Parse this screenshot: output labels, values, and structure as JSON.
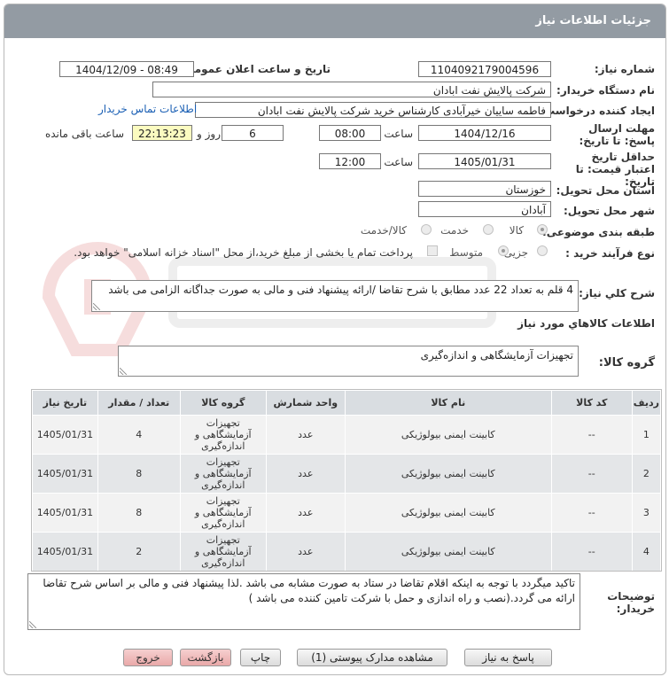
{
  "titlebar": {
    "title": "جزئیات اطلاعات نیاز"
  },
  "form": {
    "need_number_label": "شماره نیاز:",
    "need_number": "1104092179004596",
    "announce_label": "تاریخ و ساعت اعلان عمومی:",
    "announce_value": "1404/12/09 - 08:49",
    "buyer_org_label": "نام دستگاه خریدار:",
    "buyer_org": "شرکت پالایش نفت ابادان",
    "requester_label": "ایجاد کننده درخواست:",
    "requester": "فاطمه ساییان خیرآبادی کارشناس خرید شرکت پالایش نفت ابادان",
    "contact_link": "اطلاعات تماس خریدار",
    "deadline_label": "مهلت ارسال پاسخ: تا تاریخ:",
    "deadline_date": "1404/12/16",
    "time_label": "ساعت",
    "deadline_time": "08:00",
    "days_value": "6",
    "days_and": "روز و",
    "remaining_time": "22:13:23",
    "remaining_label": "ساعت باقی مانده",
    "validity_label": "حداقل تاریخ اعتبار قیمت: تا تاریخ:",
    "validity_date": "1405/01/31",
    "validity_time_label": "ساعت",
    "validity_time": "12:00",
    "province_label": "استان محل تحویل:",
    "province": "خوزستان",
    "city_label": "شهر محل تحویل:",
    "city": "آبادان",
    "category_label": "طبقه بندی موضوعی:",
    "category_options": [
      "کالا",
      "خدمت",
      "کالا/خدمت"
    ],
    "process_label": "نوع فرآیند خرید :",
    "process_options": [
      "جزیی",
      "متوسط"
    ],
    "payment_note": "پرداخت تمام یا بخشی از مبلغ خرید،از محل \"اسناد خزانه اسلامی\" خواهد بود.",
    "description_label": "شرح کلي نیاز:",
    "description": "4 قلم به تعداد 22 عدد مطابق با شرح تقاضا /ارائه پیشنهاد فنی و مالی به صورت جداگانه الزامی می باشد",
    "goods_info_title": "اطلاعات کالاهاي مورد نیاز",
    "goods_group_label": "گروه کالا:",
    "goods_group": "تجهیزات آزمایشگاهی و اندازه‌گیری",
    "buyer_notes_label": "توضیحات خریدار:",
    "buyer_notes": "تاکید میگردد با توجه به اینکه اقلام تقاضا در ستاد به صورت مشابه می باشد .لذا پیشنهاد فنی و مالی بر اساس شرح تقاضا ارائه می گردد.(نصب و راه اندازی و حمل با شرکت تامین کننده می باشد )"
  },
  "table": {
    "headers": [
      "ردیف",
      "کد کالا",
      "نام کالا",
      "واحد شمارش",
      "گروه کالا",
      "تعداد / مقدار",
      "تاریخ نیاز"
    ],
    "rows": [
      [
        "1",
        "--",
        "کابینت ایمنی بیولوژیکی",
        "عدد",
        "تجهیزات آزمایشگاهی و اندازه‌گیری",
        "4",
        "1405/01/31"
      ],
      [
        "2",
        "--",
        "کابینت ایمنی بیولوژیکی",
        "عدد",
        "تجهیزات آزمایشگاهی و اندازه‌گیری",
        "8",
        "1405/01/31"
      ],
      [
        "3",
        "--",
        "کابینت ایمنی بیولوژیکی",
        "عدد",
        "تجهیزات آزمایشگاهی و اندازه‌گیری",
        "8",
        "1405/01/31"
      ],
      [
        "4",
        "--",
        "کابینت ایمنی بیولوژیکی",
        "عدد",
        "تجهیزات آزمایشگاهی و اندازه‌گیری",
        "2",
        "1405/01/31"
      ]
    ]
  },
  "buttons": {
    "reply": "پاسخ به نیاز",
    "attachments": "مشاهده مدارک پیوستی (1)",
    "print": "چاپ",
    "back": "بازگشت",
    "exit": "خروج"
  },
  "colors": {
    "titlebar": "#939ba3",
    "table_header": "#d9dde1",
    "exit_button": "#e9a9a9",
    "link": "#1a5fb4"
  }
}
